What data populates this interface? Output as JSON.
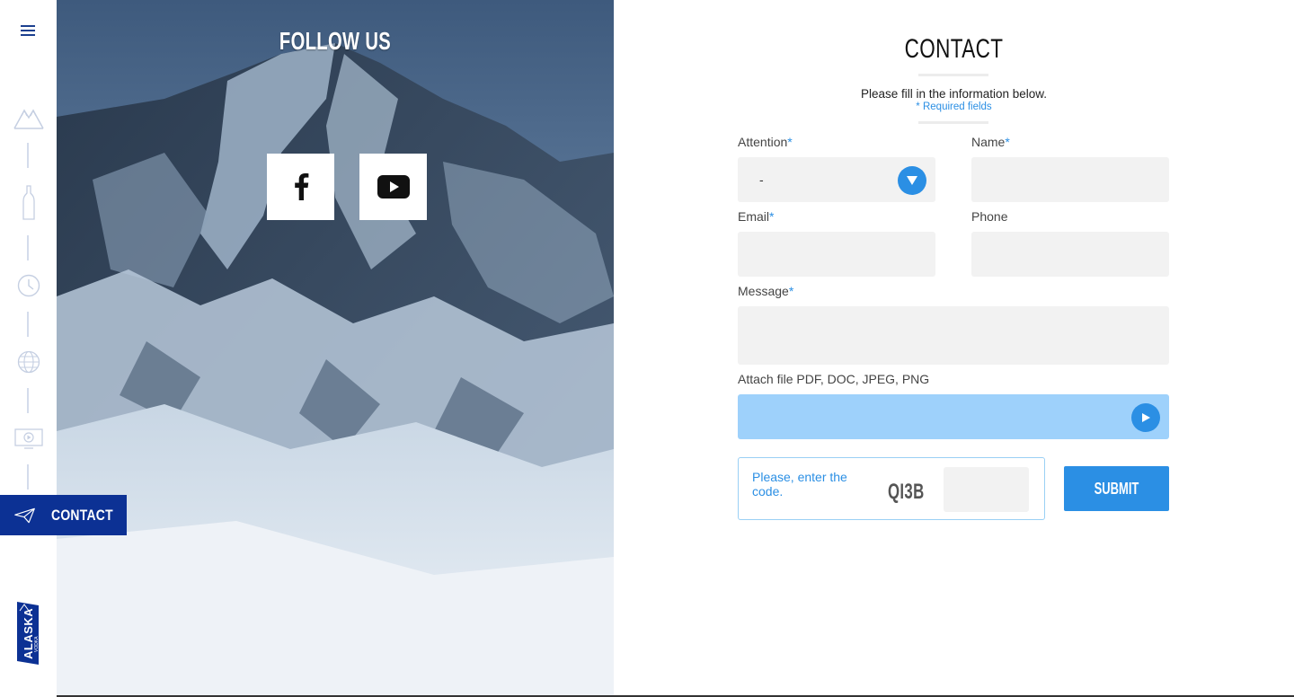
{
  "sidebar": {
    "menu_icon": "hamburger-icon",
    "nav_icons": [
      "mountain-icon",
      "bottle-icon",
      "clock-icon",
      "globe-icon",
      "video-icon"
    ],
    "active_item": {
      "icon": "paper-plane-icon",
      "label": "CONTACT"
    },
    "logo": {
      "brand": "ALASKA",
      "sub": "VODKA"
    }
  },
  "hero": {
    "title": "FOLLOW US",
    "social": [
      {
        "name": "facebook",
        "icon": "facebook-icon"
      },
      {
        "name": "youtube",
        "icon": "youtube-icon"
      }
    ]
  },
  "form": {
    "title": "CONTACT",
    "intro": "Please fill in the information below.",
    "required_note": "* Required fields",
    "fields": {
      "attention": {
        "label": "Attention",
        "required": "*",
        "value": "-"
      },
      "name": {
        "label": "Name",
        "required": "*",
        "value": ""
      },
      "email": {
        "label": "Email",
        "required": "*",
        "value": ""
      },
      "phone": {
        "label": "Phone",
        "value": ""
      },
      "message": {
        "label": "Message",
        "required": "*",
        "value": ""
      }
    },
    "attach_label": "Attach file PDF, DOC, JPEG, PNG",
    "captcha": {
      "prompt": "Please, enter the code.",
      "code": "QI3B",
      "value": ""
    },
    "submit_label": "SUBMIT"
  },
  "colors": {
    "accent": "#2b8fe4",
    "nav_active": "#0c3194",
    "field_bg": "#f2f2f2",
    "attach_bg": "#9ed1fb"
  }
}
